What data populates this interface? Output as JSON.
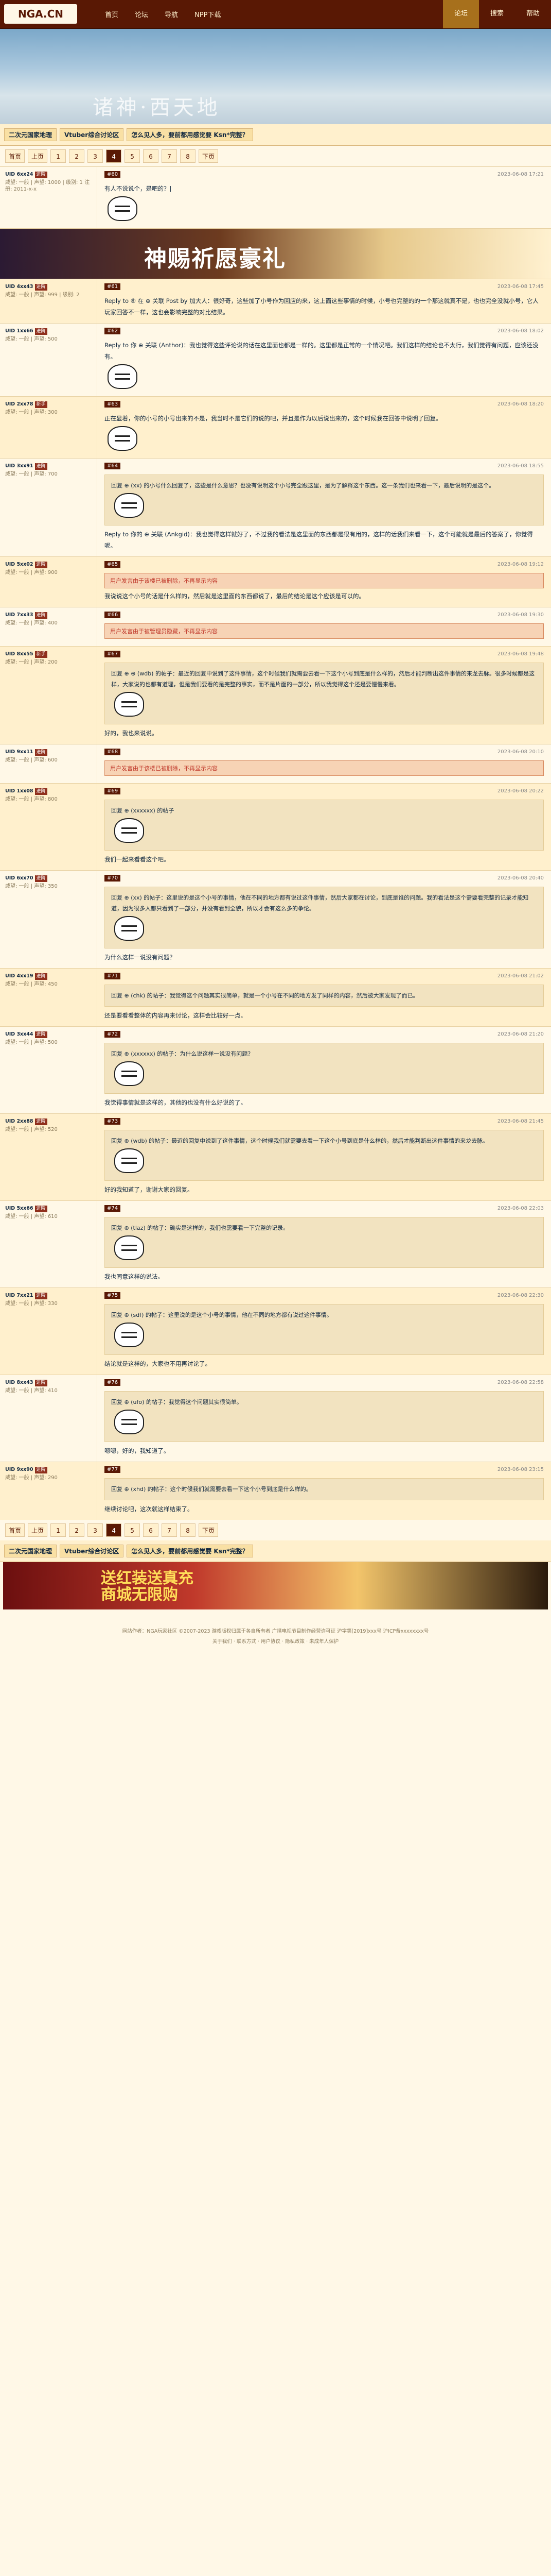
{
  "logo": "NGA.CN",
  "nav_left": [
    "首页",
    "论坛",
    "导航",
    "NPP下载"
  ],
  "nav_right": [
    "论坛",
    "搜索",
    "帮助"
  ],
  "banner_title": "诸神·西天地",
  "hot": [
    "二次元国家地理",
    "Vtuber综合讨论区",
    "怎么见人多，要前都用感觉要 Ksn*完整？"
  ],
  "pager": [
    "首页",
    "上页",
    "1",
    "2",
    "3",
    "4",
    "5",
    "6",
    "7",
    "8",
    "下页"
  ],
  "pager_cur": "4",
  "ad_title": "神赐祈愿豪礼",
  "bottom_ad": "送红装送真充\n商城无限购",
  "footer_copy": "网站作者：NGA玩家社区 ©2007-2023  游戏版权归属于各自所有者  广播电视节目制作经营许可证 沪字第[2019]xxx号  沪ICP备xxxxxxxx号",
  "footer_links": "关于我们 · 联系方式 · 用户协议 · 隐私政策 · 未成年人保护",
  "posts": [
    {
      "uid": "UID 6xx24",
      "lvl": "进阶",
      "stats": "威望: 一般 | 声望: 1000 | 级别: 1  注册: 2011-x-x",
      "floor": "#60",
      "date": "2023-06-08 17:21",
      "text": "有人不说说个，是吧的？|",
      "notice": "",
      "quote": "",
      "img": "face"
    },
    {
      "uid": "UID 4xx43",
      "lvl": "进阶",
      "stats": "威望: 一般 | 声望: 999 | 级别: 2",
      "floor": "#61",
      "date": "2023-06-08 17:45",
      "text": "Reply to ⑤ 在 ⊕ 关联 Post by 加大人：很好奇，这些加了小号作为回应的来，这上面这些事情的时候，小号也完整的的一个那这就真不是，也也完全没就小号，它人玩家回答不一样，这也会影响完整的对比结果。",
      "notice": "",
      "quote": "",
      "img": ""
    },
    {
      "uid": "UID 1xx66",
      "lvl": "进阶",
      "stats": "威望: 一般 | 声望: 500",
      "floor": "#62",
      "date": "2023-06-08 18:02",
      "text": "Reply to 你 ⊕ 关联 (Anthor)：我也觉得这些评论说的话在这里面也都是一样的。这里都是正常的一个情况吧。我们这样的结论也不太行，我们觉得有问题，应该还没有。",
      "notice": "",
      "quote": "",
      "img": "face"
    },
    {
      "uid": "UID 2xx78",
      "lvl": "新手",
      "stats": "威望: 一般 | 声望: 300",
      "floor": "#63",
      "date": "2023-06-08 18:20",
      "text": "正在显着，你的小号的小号出来的不是，我当时不是它们的说的吧，并且是作为以后说出来的，这个时候我在回答中说明了回复。",
      "notice": "",
      "quote": "",
      "img": "face"
    },
    {
      "uid": "UID 3xx91",
      "lvl": "进阶",
      "stats": "威望: 一般 | 声望: 700",
      "floor": "#64",
      "date": "2023-06-08 18:55",
      "text": "Reply to 你的 ⊕ 关联 (Ankgid)：我也觉得这样就好了，不过我的看法是这里面的东西都是很有用的，这样的话我们来看一下，这个可能就是最后的答案了，你觉得呢。",
      "notice": "",
      "quote": "回复 ⊕ (xx) 的小号什么回复了，这些是什么意思？也没有说明这个小号完全跟这里，是为了解释这个东西。这一条我们也来看一下，最后说明的是这个。",
      "img": "face"
    },
    {
      "uid": "UID 5xx02",
      "lvl": "进阶",
      "stats": "威望: 一般 | 声望: 900",
      "floor": "#65",
      "date": "2023-06-08 19:12",
      "text": "我说说这个小号的话是什么样的，然后就是这里面的东西都说了，最后的结论是这个应该是可以的。",
      "notice": "用户发言由于该楼已被删除，不再显示内容",
      "quote": "",
      "img": ""
    },
    {
      "uid": "UID 7xx33",
      "lvl": "进阶",
      "stats": "威望: 一般 | 声望: 400",
      "floor": "#66",
      "date": "2023-06-08 19:30",
      "text": "",
      "notice": "用户发言由于被管理员隐藏，不再显示内容",
      "quote": "",
      "img": ""
    },
    {
      "uid": "UID 8xx55",
      "lvl": "新手",
      "stats": "威望: 一般 | 声望: 200",
      "floor": "#67",
      "date": "2023-06-08 19:48",
      "text": "好的，我也来说说。",
      "notice": "",
      "quote": "回复 ⊕ ⊕ (wdb) 的帖子：最近的回复中说到了这件事情，这个时候我们就需要去看一下这个小号到底是什么样的，然后才能判断出这件事情的来龙去脉。很多时候都是这样，大家说的也都有道理，但是我们要看的是完整的事实，而不是片面的一部分，所以我觉得这个还是要慢慢来看。",
      "img": "face"
    },
    {
      "uid": "UID 9xx11",
      "lvl": "进阶",
      "stats": "威望: 一般 | 声望: 600",
      "floor": "#68",
      "date": "2023-06-08 20:10",
      "text": "",
      "notice": "用户发言由于该楼已被删除，不再显示内容",
      "quote": "",
      "img": ""
    },
    {
      "uid": "UID 1xx08",
      "lvl": "进阶",
      "stats": "威望: 一般 | 声望: 800",
      "floor": "#69",
      "date": "2023-06-08 20:22",
      "text": "我们一起来看看这个吧。",
      "notice": "",
      "quote": "回复 ⊕ (xxxxxx) 的帖子",
      "img": "face"
    },
    {
      "uid": "UID 6xx70",
      "lvl": "进阶",
      "stats": "威望: 一般 | 声望: 350",
      "floor": "#70",
      "date": "2023-06-08 20:40",
      "text": "为什么这样一说没有问题？",
      "notice": "",
      "quote": "回复 ⊕ (xx) 的帖子：这里说的是这个小号的事情，他在不同的地方都有说过这件事情，然后大家都在讨论，到底是谁的问题。我的看法是这个需要看完整的记录才能知道，因为很多人都只看到了一部分，并没有看到全貌，所以才会有这么多的争论。",
      "img": "face"
    },
    {
      "uid": "UID 4xx19",
      "lvl": "进阶",
      "stats": "威望: 一般 | 声望: 450",
      "floor": "#71",
      "date": "2023-06-08 21:02",
      "text": "还是要看看整体的内容再来讨论，这样会比较好一点。",
      "notice": "",
      "quote": "回复 ⊕ (chk) 的帖子：我觉得这个问题其实很简单，就是一个小号在不同的地方发了同样的内容，然后被大家发现了而已。",
      "img": ""
    },
    {
      "uid": "UID 3xx44",
      "lvl": "进阶",
      "stats": "威望: 一般 | 声望: 500",
      "floor": "#72",
      "date": "2023-06-08 21:20",
      "text": "我觉得事情就是这样的，其他的也没有什么好说的了。",
      "notice": "",
      "quote": "回复 ⊕ (xxxxxx) 的帖子：为什么说这样一说没有问题？",
      "img": "face"
    },
    {
      "uid": "UID 2xx88",
      "lvl": "进阶",
      "stats": "威望: 一般 | 声望: 520",
      "floor": "#73",
      "date": "2023-06-08 21:45",
      "text": "好的我知道了，谢谢大家的回复。",
      "notice": "",
      "quote": "回复 ⊕ (wdb) 的帖子：最近的回复中说到了这件事情，这个时候我们就需要去看一下这个小号到底是什么样的，然后才能判断出这件事情的来龙去脉。",
      "img": "face"
    },
    {
      "uid": "UID 5xx66",
      "lvl": "进阶",
      "stats": "威望: 一般 | 声望: 610",
      "floor": "#74",
      "date": "2023-06-08 22:03",
      "text": "我也同意这样的说法。",
      "notice": "",
      "quote": "回复 ⊕ (tlaz) 的帖子：确实是这样的，我们也需要看一下完整的记录。",
      "img": "face"
    },
    {
      "uid": "UID 7xx21",
      "lvl": "进阶",
      "stats": "威望: 一般 | 声望: 330",
      "floor": "#75",
      "date": "2023-06-08 22:30",
      "text": "结论就是这样的，大家也不用再讨论了。",
      "notice": "",
      "quote": "回复 ⊕ (sdf) 的帖子：这里说的是这个小号的事情，他在不同的地方都有说过这件事情。",
      "img": "face"
    },
    {
      "uid": "UID 8xx43",
      "lvl": "进阶",
      "stats": "威望: 一般 | 声望: 410",
      "floor": "#76",
      "date": "2023-06-08 22:58",
      "text": "嗯嗯，好的，我知道了。",
      "notice": "",
      "quote": "回复 ⊕ (ufo) 的帖子：我觉得这个问题其实很简单。",
      "img": "face"
    },
    {
      "uid": "UID 9xx90",
      "lvl": "进阶",
      "stats": "威望: 一般 | 声望: 290",
      "floor": "#77",
      "date": "2023-06-08 23:15",
      "text": "继续讨论吧，这次就这样结束了。",
      "notice": "",
      "quote": "回复 ⊕ (xhd) 的帖子：这个时候我们就需要去看一下这个小号到底是什么样的。",
      "img": ""
    }
  ]
}
